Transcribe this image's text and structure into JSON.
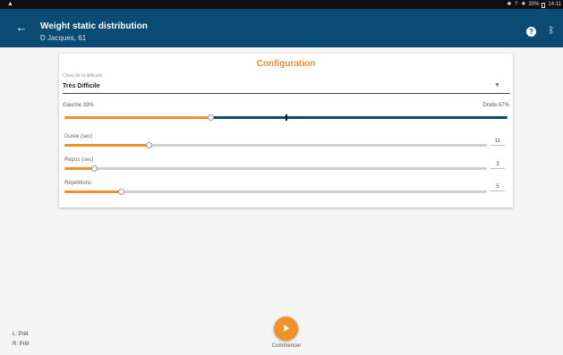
{
  "status_bar": {
    "warning_icon": "warning-icon",
    "bluetooth_icon": "bluetooth-icon",
    "wifi_icon": "wifi-icon",
    "battery_text": "30%",
    "time": "14:11"
  },
  "app_bar": {
    "title": "Weight static distribution",
    "subtitle": "D Jacques, 61",
    "back_icon": "arrow-left-icon",
    "help_icon": "help-icon",
    "bluetooth_icon": "bluetooth-icon"
  },
  "config": {
    "title": "Configuration",
    "difficulty_label": "Choix de la difficulté",
    "difficulty_value": "Très Difficile",
    "balance": {
      "left_label": "Gauche 33%",
      "right_label": "Droite 67%",
      "left_fraction": 0.33
    },
    "sliders": [
      {
        "label": "Durée (sec)",
        "value": "11",
        "fraction": 0.2
      },
      {
        "label": "Repos (sec)",
        "value": "3",
        "fraction": 0.07
      },
      {
        "label": "Répétitions",
        "value": "5",
        "fraction": 0.135
      }
    ]
  },
  "footer": {
    "left_status": "L: Prêt",
    "right_status": "R: Prêt",
    "start_label": "Commencer",
    "start_icon": "play-icon"
  },
  "colors": {
    "primary": "#0b4a74",
    "accent": "#f0922a"
  }
}
